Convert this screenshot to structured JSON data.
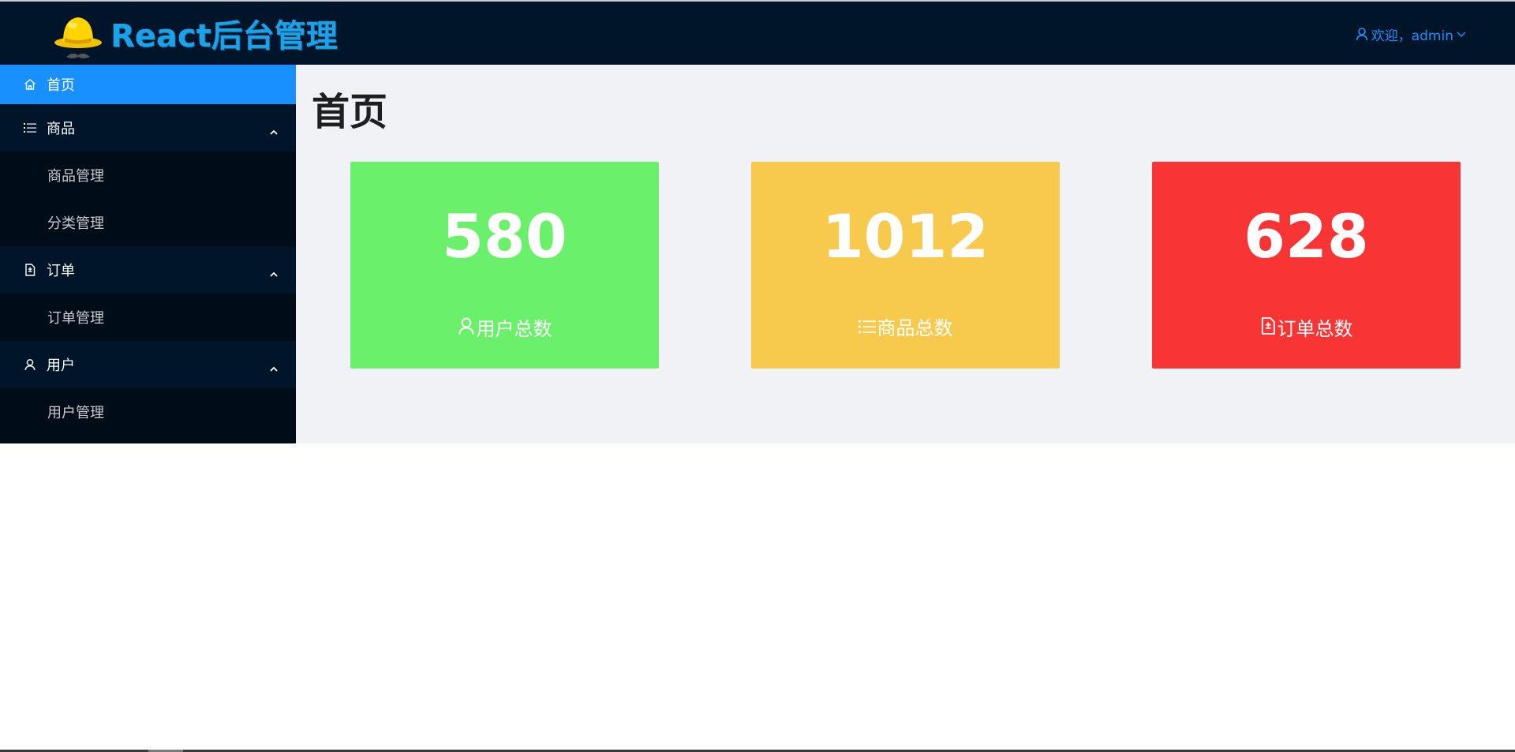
{
  "header": {
    "app_title": "React后台管理",
    "user_greeting": "欢迎，admin"
  },
  "sidebar": {
    "items": [
      {
        "label": "首页",
        "icon": "home-icon",
        "active": true
      },
      {
        "label": "商品",
        "icon": "list-icon",
        "expanded": true,
        "children": [
          {
            "label": "商品管理"
          },
          {
            "label": "分类管理"
          }
        ]
      },
      {
        "label": "订单",
        "icon": "file-icon",
        "expanded": true,
        "children": [
          {
            "label": "订单管理"
          }
        ]
      },
      {
        "label": "用户",
        "icon": "user-icon",
        "expanded": true,
        "children": [
          {
            "label": "用户管理"
          }
        ]
      }
    ]
  },
  "main": {
    "page_title": "首页",
    "stats": [
      {
        "value": "580",
        "label": "用户总数",
        "icon": "user-icon",
        "color": "#6bf06b"
      },
      {
        "value": "1012",
        "label": "商品总数",
        "icon": "list-icon",
        "color": "#f7ca4e"
      },
      {
        "value": "628",
        "label": "订单总数",
        "icon": "file-icon",
        "color": "#f93434"
      }
    ]
  },
  "colors": {
    "header_bg": "#001529",
    "sidebar_bg": "#000c17",
    "accent": "#1890ff",
    "content_bg": "#f0f2f5"
  }
}
